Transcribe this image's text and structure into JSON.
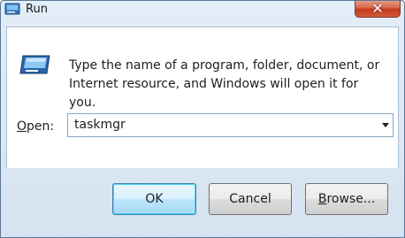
{
  "window": {
    "title": "Run",
    "close_glyph": "✕"
  },
  "dialog": {
    "description_line1": "Type the name of a program, folder, document, or",
    "description_line2": "Internet resource, and Windows will open it for you.",
    "open_label_mnemonic": "O",
    "open_label_rest": "pen:",
    "open_value": "taskmgr"
  },
  "buttons": {
    "ok": "OK",
    "cancel": "Cancel",
    "browse_mnemonic": "B",
    "browse_rest": "rowse..."
  },
  "colors": {
    "frame": "#d5e3f0",
    "close_button": "#c4391c",
    "default_button_border": "#3c7fb1"
  }
}
